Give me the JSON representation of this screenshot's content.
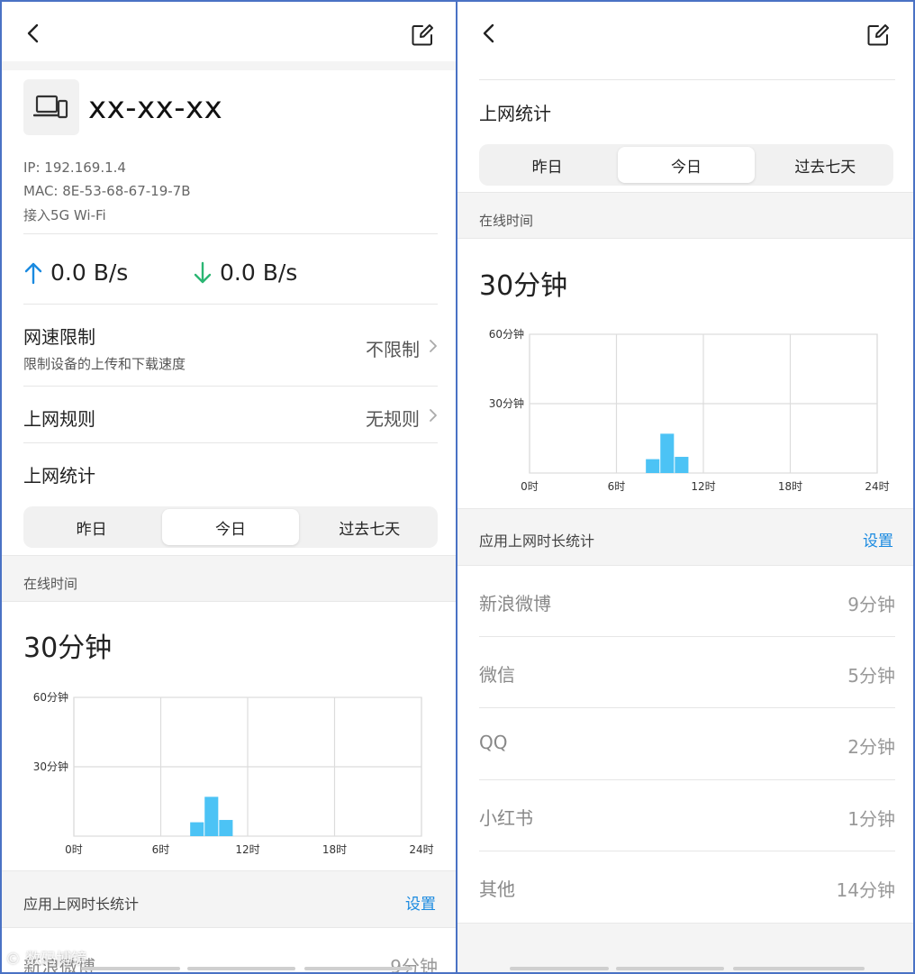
{
  "device": {
    "name": "xx-xx-xx",
    "ip": "IP: 192.169.1.4",
    "mac": "MAC: 8E-53-68-67-19-7B",
    "connection": "接入5G Wi-Fi",
    "upload_speed": "0.0 B/s",
    "download_speed": "0.0 B/s"
  },
  "speed_limit": {
    "title": "网速限制",
    "subtitle": "限制设备的上传和下载速度",
    "value": "不限制"
  },
  "rules": {
    "title": "上网规则",
    "value": "无规则"
  },
  "stats": {
    "title": "上网统计",
    "tabs": [
      "昨日",
      "今日",
      "过去七天"
    ],
    "active_tab": "今日",
    "online_time_label": "在线时间",
    "online_time_value": "30分钟"
  },
  "chart_data": {
    "type": "bar",
    "title": "",
    "xlabel": "",
    "ylabel": "",
    "x_ticks": [
      "0时",
      "6时",
      "12时",
      "18时",
      "24时"
    ],
    "y_ticks": [
      "60分钟",
      "30分钟"
    ],
    "xlim": [
      0,
      24
    ],
    "ylim": [
      0,
      60
    ],
    "grid": true,
    "categories": [
      8,
      9,
      10
    ],
    "values": [
      6,
      17,
      7
    ],
    "bar_color": "#4cc3f5"
  },
  "app_stats": {
    "title": "应用上网时长统计",
    "settings_label": "设置",
    "items": [
      {
        "name": "新浪微博",
        "value": "9分钟"
      },
      {
        "name": "微信",
        "value": "5分钟"
      },
      {
        "name": "QQ",
        "value": "2分钟"
      },
      {
        "name": "小红书",
        "value": "1分钟"
      },
      {
        "name": "其他",
        "value": "14分钟"
      }
    ]
  },
  "watermark": "© 数码博镜",
  "colors": {
    "accent_blue": "#1a8ae0",
    "upload_arrow": "#1a8ae0",
    "download_arrow": "#2bb673",
    "panel_border": "#4a72c4"
  }
}
